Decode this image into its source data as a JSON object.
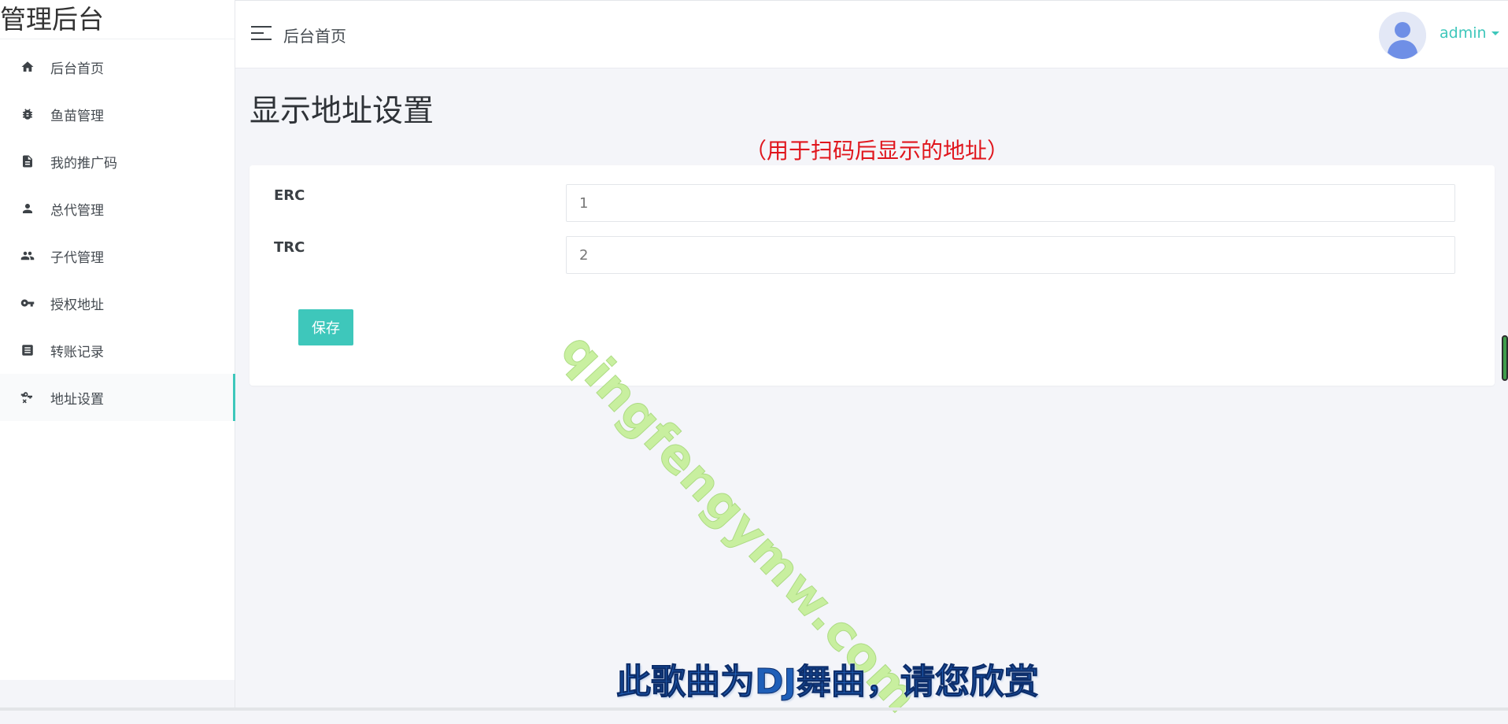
{
  "brand": "管理后台",
  "sidebar": {
    "items": [
      {
        "label": "后台首页",
        "icon": "home-icon"
      },
      {
        "label": "鱼苗管理",
        "icon": "bug-icon"
      },
      {
        "label": "我的推广码",
        "icon": "document-icon"
      },
      {
        "label": "总代管理",
        "icon": "person-icon"
      },
      {
        "label": "子代管理",
        "icon": "people-icon"
      },
      {
        "label": "授权地址",
        "icon": "key-icon"
      },
      {
        "label": "转账记录",
        "icon": "note-icon"
      },
      {
        "label": "地址设置",
        "icon": "key-off-icon",
        "active": true
      }
    ]
  },
  "header": {
    "breadcrumb": "后台首页",
    "user": "admin"
  },
  "main": {
    "title": "显示地址设置",
    "notice": "（用于扫码后显示的地址）",
    "fields": [
      {
        "label": "ERC",
        "value": "1"
      },
      {
        "label": "TRC",
        "value": "2"
      }
    ],
    "save_label": "保存"
  },
  "overlay": {
    "watermark": "qingfengymw.com",
    "subtitle": "此歌曲为DJ舞曲，请您欣赏"
  },
  "colors": {
    "accent": "#3ec7bb",
    "notice": "#e0161d",
    "background": "#f4f5f9"
  }
}
